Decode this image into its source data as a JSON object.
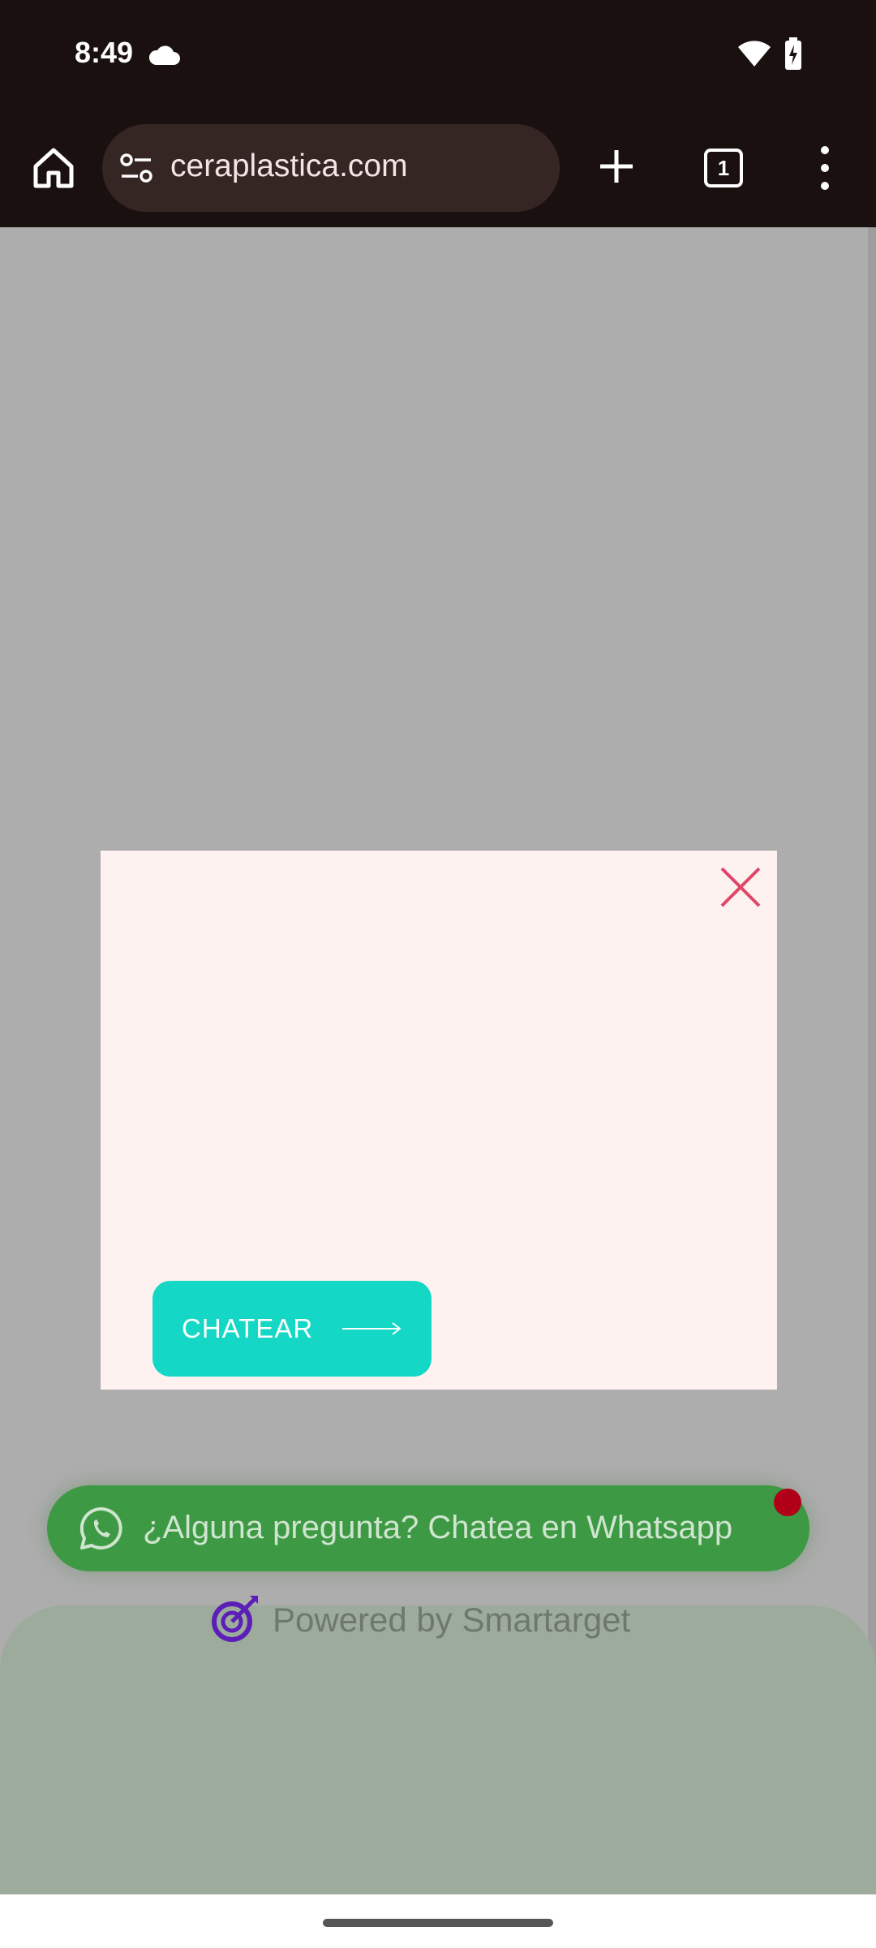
{
  "status_bar": {
    "time": "8:49"
  },
  "browser": {
    "url": "ceraplastica.com",
    "tab_count": "1"
  },
  "popup": {
    "chat_button_label": "CHATEAR"
  },
  "whatsapp_widget": {
    "label": "¿Alguna pregunta? Chatea en Whatsapp",
    "powered_by": "Powered by Smartarget"
  },
  "colors": {
    "popup_bg": "#fdf2ef",
    "chat_button": "#14d8c5",
    "close_icon": "#e0476a",
    "whatsapp_green": "#3d9944",
    "notification_dot": "#b00018",
    "smartarget_purple": "#5b1fb8"
  }
}
